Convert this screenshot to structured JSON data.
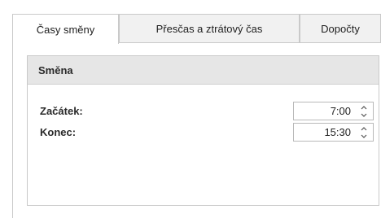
{
  "tabs": [
    {
      "label": "Časy směny",
      "active": true
    },
    {
      "label": "Přesčas a ztrátový čas",
      "active": false
    },
    {
      "label": "Dopočty",
      "active": false
    }
  ],
  "group": {
    "title": "Směna"
  },
  "fields": {
    "start": {
      "label": "Začátek:",
      "value": "7:00"
    },
    "end": {
      "label": "Konec:",
      "value": "15:30"
    }
  },
  "icons": {
    "spin_up": "chevron-up-icon",
    "spin_down": "chevron-down-icon"
  },
  "colors": {
    "border": "#c9c9c9",
    "inactive_tab_bg": "#f1f1f1",
    "group_header_bg": "#e6e6e6",
    "text": "#202020"
  }
}
